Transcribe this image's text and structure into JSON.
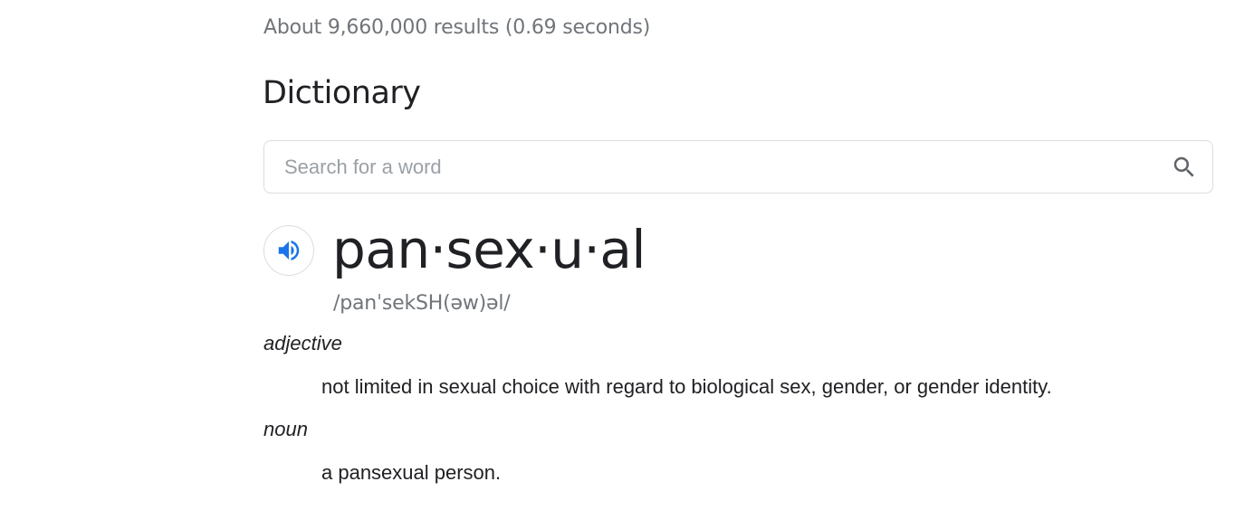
{
  "results_stats": "About 9,660,000 results (0.69 seconds)",
  "dictionary": {
    "title": "Dictionary",
    "search": {
      "placeholder": "Search for a word",
      "value": "",
      "icon": "search-icon"
    },
    "audio_icon": "speaker-icon",
    "accent_color": "#1a73e8",
    "headword": "pan·sex·u·al",
    "phonetic": "/panˈsekSH(əw)əl/",
    "senses": [
      {
        "part_of_speech": "adjective",
        "definition": "not limited in sexual choice with regard to biological sex, gender, or gender identity."
      },
      {
        "part_of_speech": "noun",
        "definition": "a pansexual person."
      }
    ]
  }
}
